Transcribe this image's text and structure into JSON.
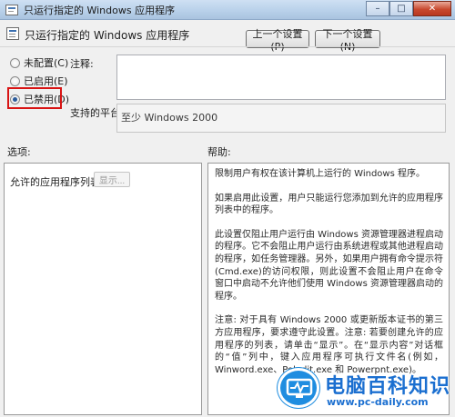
{
  "window": {
    "title": "只运行指定的 Windows 应用程序",
    "minimize_glyph": "–",
    "maximize_glyph": "□",
    "close_glyph": "✕"
  },
  "header": {
    "policy_title": "只运行指定的 Windows 应用程序",
    "prev_button": "上一个设置(P)",
    "next_button": "下一个设置(N)"
  },
  "state_options": [
    {
      "label": "未配置(C)",
      "selected": false
    },
    {
      "label": "已启用(E)",
      "selected": false
    },
    {
      "label": "已禁用(D)",
      "selected": true
    }
  ],
  "fields": {
    "comment_label": "注释:",
    "comment_value": "",
    "platform_label": "支持的平台:",
    "platform_value": "至少 Windows 2000"
  },
  "sections": {
    "options_label": "选项:",
    "help_label": "帮助:"
  },
  "options_panel": {
    "allowed_apps_label": "允许的应用程序列表",
    "show_button": "显示..."
  },
  "help_text": [
    "限制用户有权在该计算机上运行的 Windows 程序。",
    "如果启用此设置，用户只能运行您添加到允许的应用程序列表中的程序。",
    "此设置仅阻止用户运行由 Windows 资源管理器进程启动的程序。它不会阻止用户运行由系统进程或其他进程启动的程序，如任务管理器。另外，如果用户拥有命令提示符(Cmd.exe)的访问权限，则此设置不会阻止用户在命令窗口中启动不允许他们使用 Windows 资源管理器启动的程序。",
    "注意: 对于具有 Windows 2000 或更新版本证书的第三方应用程序，要求遵守此设置。注意: 若要创建允许的应用程序的列表，请单击“显示”。在“显示内容”对话框的“值”列中，键入应用程序可执行文件名(例如，Winword.exe、Poledit.exe 和 Powerpnt.exe)。"
  ],
  "watermark": {
    "brand_name": "电脑百科知识",
    "url": "www.pc-daily.com",
    "color": "#1b6fd0"
  }
}
